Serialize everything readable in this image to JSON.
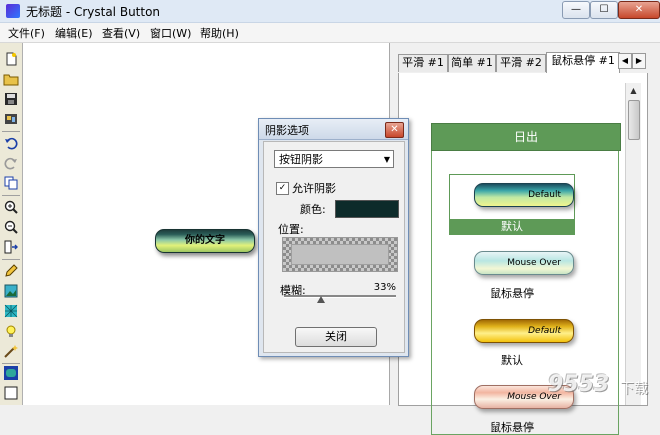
{
  "window": {
    "title": "无标题 - Crystal Button",
    "min_label": "—",
    "max_label": "☐",
    "close_label": "✕"
  },
  "menu": [
    "文件(F)",
    "编辑(E)",
    "查看(V)",
    "窗口(W)",
    "帮助(H)"
  ],
  "toolbar": {
    "tools": [
      "new-icon",
      "open-icon",
      "save-icon",
      "export-icon",
      "undo-icon",
      "redo-icon",
      "copy-icon",
      "zoom-in-icon",
      "zoom-out-icon",
      "align-icon",
      "pencil-icon",
      "image-icon",
      "texture-icon",
      "light-icon",
      "magic-icon",
      "button-shape-icon",
      "rectangle-icon"
    ]
  },
  "canvas": {
    "button_text": "你的文字"
  },
  "tabs": {
    "items": [
      "平滑 #1",
      "简单 #1",
      "平滑 #2",
      "鼠标悬停 #1"
    ],
    "active_index": 3,
    "prev_label": "◀",
    "next_label": "▶"
  },
  "gallery": {
    "header": "日出",
    "samples": [
      {
        "text": "Default",
        "caption": "默认"
      },
      {
        "text": "Mouse Over",
        "caption": "鼠标悬停"
      },
      {
        "text": "Default",
        "caption": "默认"
      },
      {
        "text": "Mouse Over",
        "caption": "鼠标悬停"
      }
    ]
  },
  "dialog": {
    "title": "阴影选项",
    "close_label": "✕",
    "dropdown_value": "按钮阴影",
    "dropdown_arrow": "▼",
    "allow_shadow_label": "允许阴影",
    "allow_shadow_checked": true,
    "check_mark": "✓",
    "color_label": "颜色:",
    "shadow_color": "#0d2b2a",
    "position_label": "位置:",
    "blur_label": "模糊:",
    "blur_value": "33%",
    "blur_percent": 33,
    "ok_label": "关闭"
  },
  "watermark": {
    "main": "9553",
    "sub": "下载"
  },
  "colors": {
    "gallery_green": "#5e9a57",
    "dialog_frame": "#6f8db5"
  }
}
